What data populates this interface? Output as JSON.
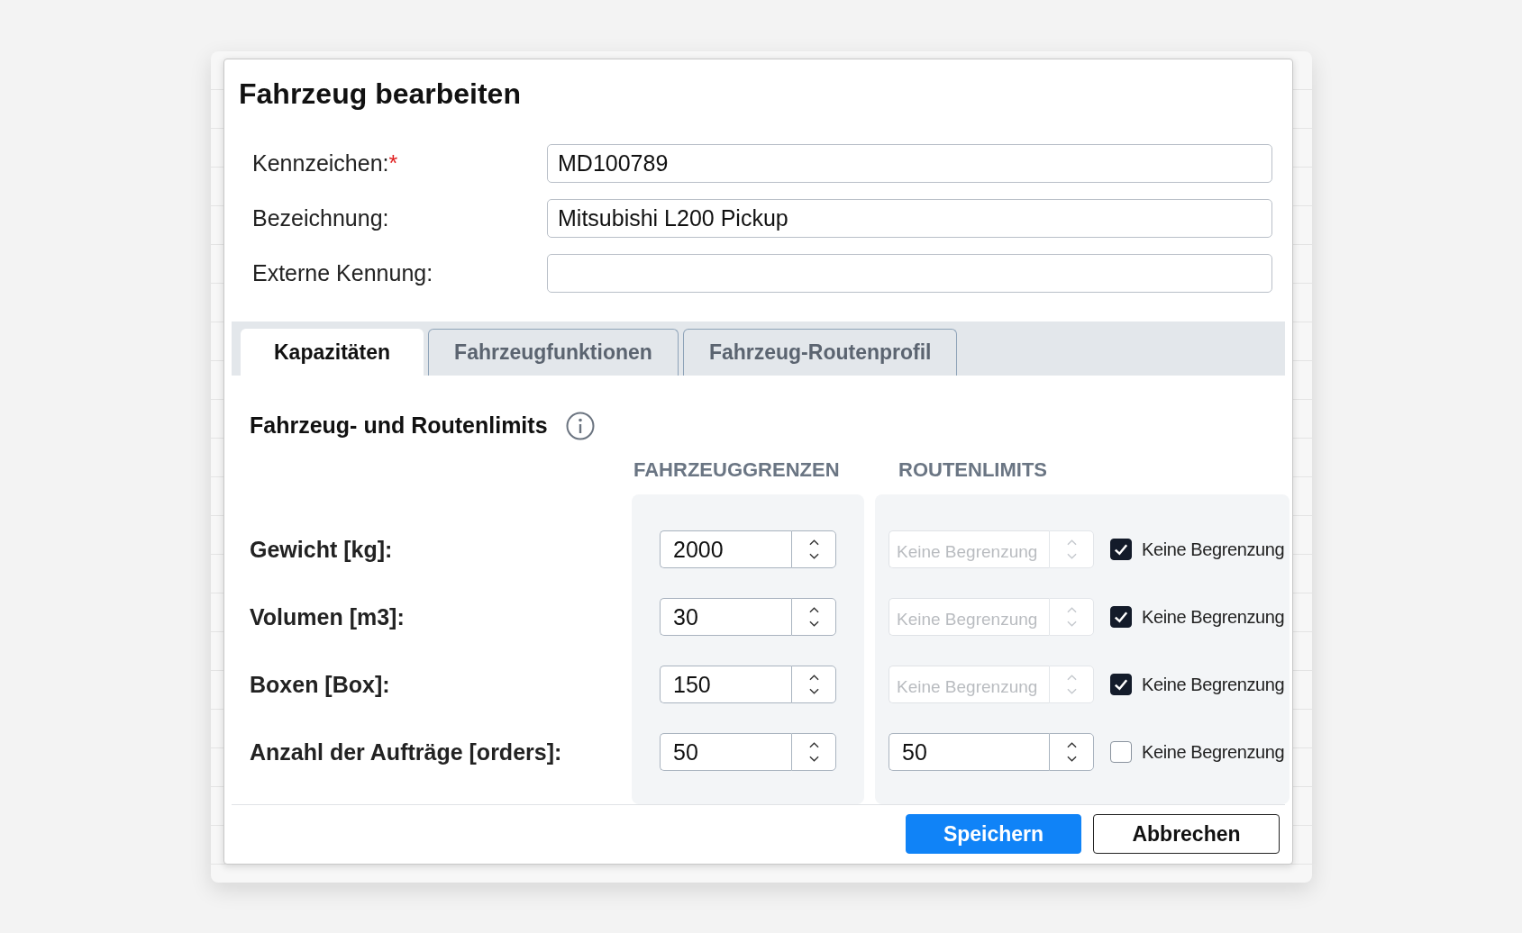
{
  "dialog": {
    "title": "Fahrzeug bearbeiten"
  },
  "fields": [
    {
      "label": "Kennzeichen:",
      "required_mark": "*",
      "value": "MD100789"
    },
    {
      "label": "Bezeichnung:",
      "value": "Mitsubishi L200 Pickup"
    },
    {
      "label": "Externe Kennung:"
    }
  ],
  "tabs": [
    {
      "label": "Kapazitäten",
      "selected": true
    },
    {
      "label": "Fahrzeugfunktionen",
      "selected": false
    },
    {
      "label": "Fahrzeug-Routenprofil",
      "selected": false
    }
  ],
  "section": {
    "title": "Fahrzeug- und Routenlimits"
  },
  "columns": [
    "FAHRZEUGGRENZEN",
    "ROUTENLIMITS"
  ],
  "rows": [
    {
      "label": "Gewicht [kg]:",
      "vehicle_value": "2000",
      "route_placeholder": "Keine Begrenzung",
      "no_limit": true,
      "no_limit_label": "Keine Begrenzung"
    },
    {
      "label": "Volumen [m3]:",
      "vehicle_value": "30",
      "route_placeholder": "Keine Begrenzung",
      "no_limit": true,
      "no_limit_label": "Keine Begrenzung"
    },
    {
      "label": "Boxen [Box]:",
      "vehicle_value": "150",
      "route_placeholder": "Keine Begrenzung",
      "no_limit": true,
      "no_limit_label": "Keine Begrenzung"
    },
    {
      "label": "Anzahl der Aufträge [orders]:",
      "vehicle_value": "50",
      "route_value": "50",
      "no_limit": false,
      "no_limit_label": "Keine Begrenzung"
    }
  ],
  "buttons": [
    {
      "label": "Speichern",
      "kind": "primary"
    },
    {
      "label": "Abbrechen",
      "kind": "secondary"
    }
  ]
}
